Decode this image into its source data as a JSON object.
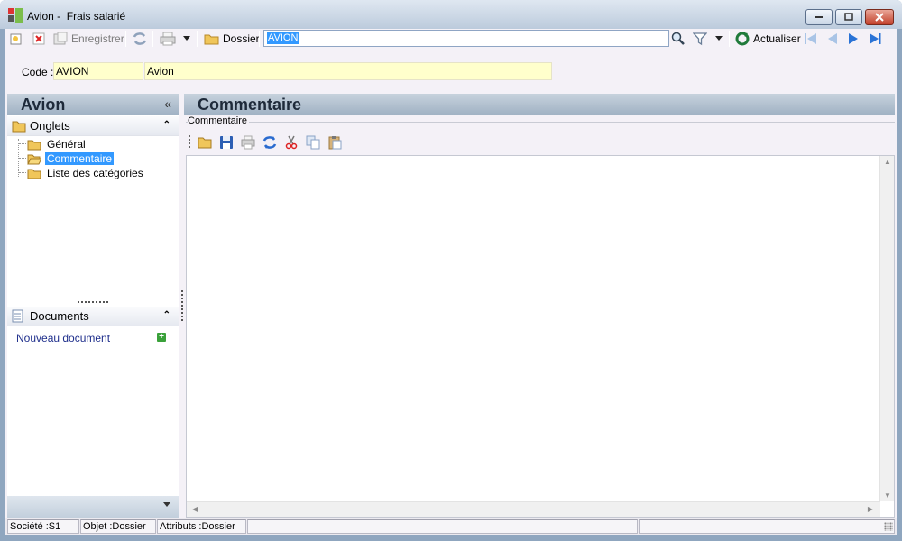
{
  "window": {
    "title": "Avion -  Frais salarié"
  },
  "toolbar": {
    "new_icon": "new-document-icon",
    "delete_icon": "delete-icon",
    "save_label": "Enregistrer",
    "refresh_icon": "refresh-icon",
    "print_icon": "printer-icon",
    "folder_label": "Dossier",
    "search_value": "AVION",
    "refresh_label": "Actualiser"
  },
  "code_row": {
    "label": "Code :",
    "code_value": "AVION",
    "name_value": "Avion"
  },
  "left_panel": {
    "title": "Avion",
    "tabs_section": {
      "label": "Onglets",
      "items": [
        {
          "label": "Général",
          "selected": false
        },
        {
          "label": "Commentaire",
          "selected": true
        },
        {
          "label": "Liste des catégories",
          "selected": false
        }
      ]
    },
    "documents_section": {
      "label": "Documents",
      "new_document": "Nouveau document"
    }
  },
  "main": {
    "title": "Commentaire",
    "group_label": "Commentaire"
  },
  "status_bar": {
    "company": "Société :S1",
    "object": "Objet :Dossier",
    "attributes": "Attributs :Dossier"
  },
  "colors": {
    "selection": "#3399ff",
    "input_bg": "#ffffcc",
    "header_bg": "#b3c2d1"
  }
}
